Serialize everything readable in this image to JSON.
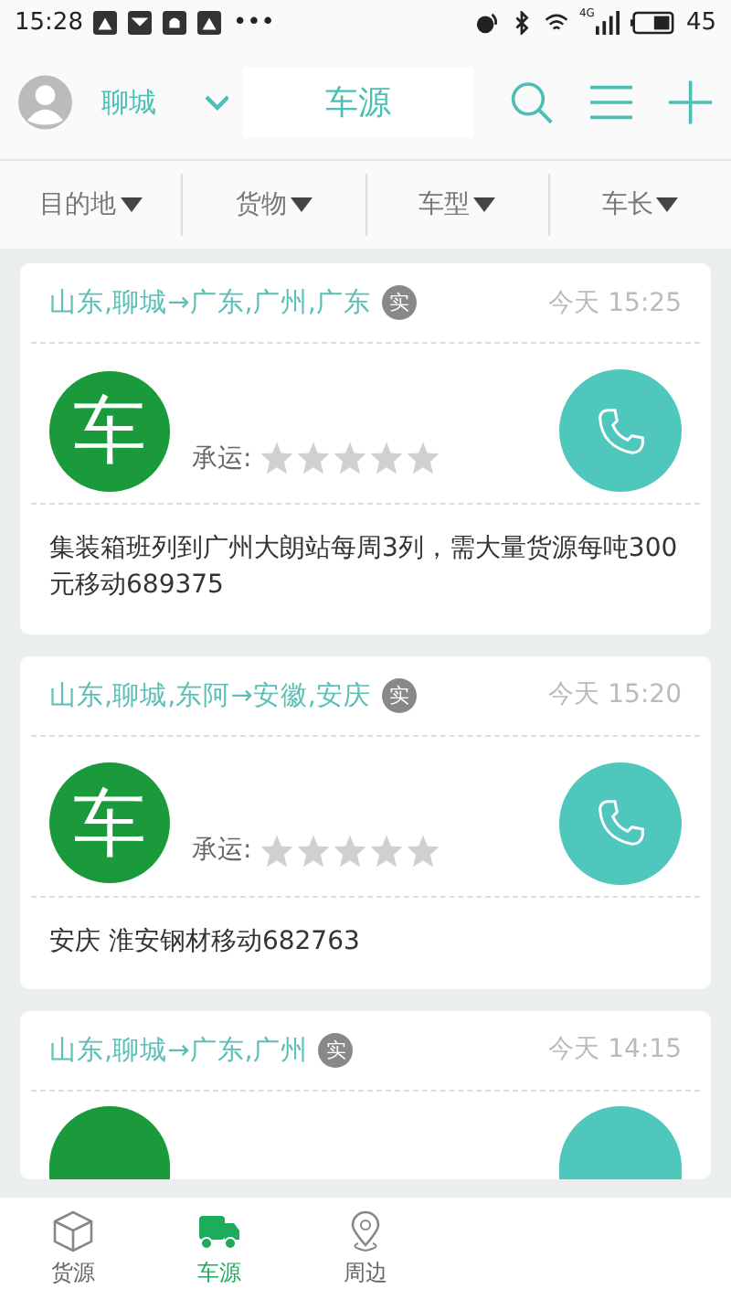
{
  "status_bar": {
    "time": "15:28",
    "more": "•••",
    "network": "4G",
    "battery": "45"
  },
  "header": {
    "city": "聊城",
    "title": "车源"
  },
  "filters": [
    {
      "label": "目的地"
    },
    {
      "label": "货物"
    },
    {
      "label": "车型"
    },
    {
      "label": "车长"
    }
  ],
  "cards": [
    {
      "route": "山东,聊城→广东,广州,广东",
      "badge": "实",
      "time": "今天 15:25",
      "avatar_text": "车",
      "rating_label": "承运:",
      "stars": 0,
      "description": "集装箱班列到广州大朗站每周3列，需大量货源每吨300元移动689375"
    },
    {
      "route": "山东,聊城,东阿→安徽,安庆",
      "badge": "实",
      "time": "今天 15:20",
      "avatar_text": "车",
      "rating_label": "承运:",
      "stars": 0,
      "description": "安庆   淮安钢材移动682763"
    },
    {
      "route": "山东,聊城→广东,广州",
      "badge": "实",
      "time": "今天 14:15"
    }
  ],
  "bottom_nav": [
    {
      "label": "货源",
      "kind": "box",
      "selected": false
    },
    {
      "label": "车源",
      "kind": "truck",
      "selected": true
    },
    {
      "label": "周边",
      "kind": "pin",
      "selected": false
    }
  ]
}
